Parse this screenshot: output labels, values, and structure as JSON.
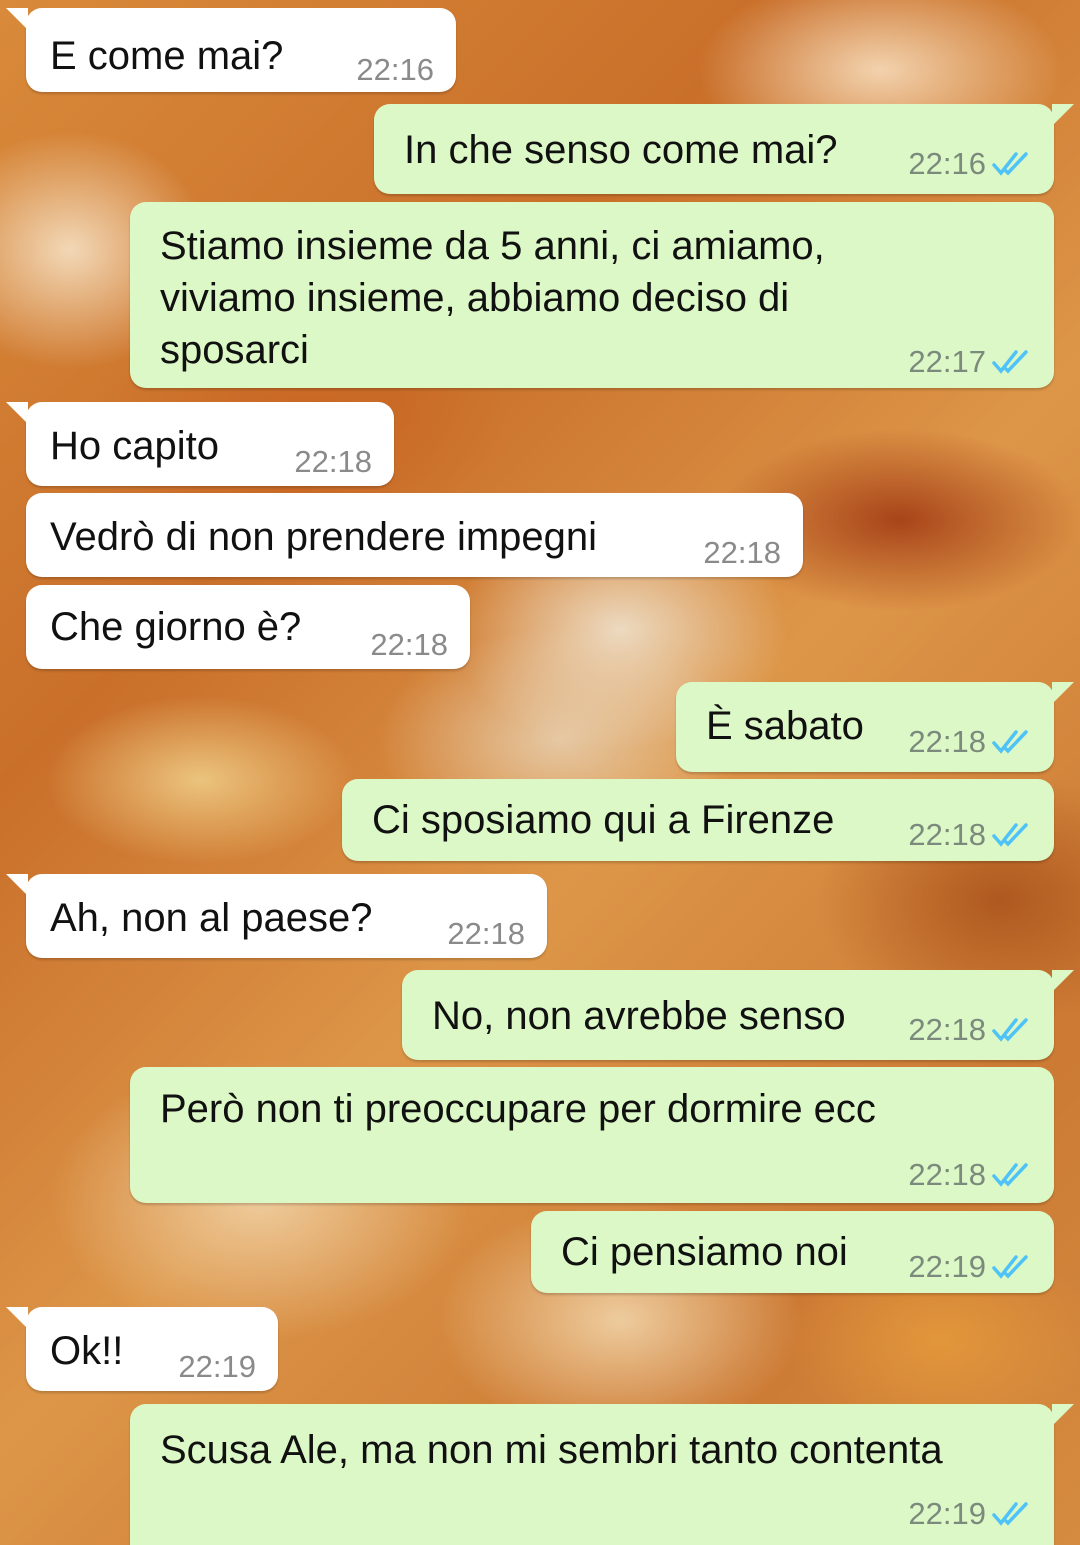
{
  "chat": {
    "messages": [
      {
        "dir": "in",
        "text": "E come mai?",
        "time": "22:16"
      },
      {
        "dir": "out",
        "text": "In che senso come mai?",
        "time": "22:16",
        "status": "read"
      },
      {
        "dir": "out",
        "text": "Stiamo insieme da 5 anni, ci amiamo, viviamo insieme, abbiamo deciso di sposarci",
        "time": "22:17",
        "status": "read"
      },
      {
        "dir": "in",
        "text": "Ho capito",
        "time": "22:18"
      },
      {
        "dir": "in",
        "text": "Vedrò di non prendere impegni",
        "time": "22:18"
      },
      {
        "dir": "in",
        "text": "Che giorno è?",
        "time": "22:18"
      },
      {
        "dir": "out",
        "text": "È sabato",
        "time": "22:18",
        "status": "read"
      },
      {
        "dir": "out",
        "text": "Ci sposiamo qui a Firenze",
        "time": "22:18",
        "status": "read"
      },
      {
        "dir": "in",
        "text": "Ah, non al paese?",
        "time": "22:18"
      },
      {
        "dir": "out",
        "text": "No, non avrebbe senso",
        "time": "22:18",
        "status": "read"
      },
      {
        "dir": "out",
        "text": "Però non ti preoccupare per dormire ecc",
        "time": "22:18",
        "status": "read"
      },
      {
        "dir": "out",
        "text": "Ci pensiamo noi",
        "time": "22:19",
        "status": "read"
      },
      {
        "dir": "in",
        "text": "Ok!!",
        "time": "22:19"
      },
      {
        "dir": "out",
        "text": "Scusa Ale, ma non mi sembri tanto contenta",
        "time": "22:19",
        "status": "read"
      }
    ],
    "read_tick_color": "#4fc3f7",
    "incoming_bubble_color": "#ffffff",
    "outgoing_bubble_color": "#dcf8c6",
    "tick_icon": "double-check-icon"
  }
}
